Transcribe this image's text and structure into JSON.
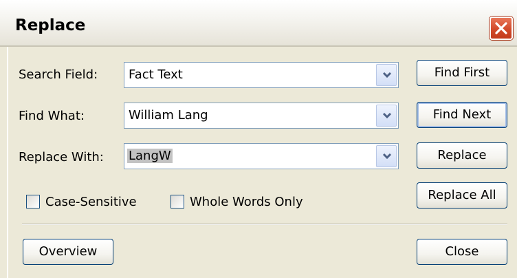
{
  "window": {
    "title": "Replace"
  },
  "fields": {
    "search_field": {
      "label": "Search Field:",
      "value": "Fact Text"
    },
    "find_what": {
      "label": "Find What:",
      "value": "William Lang"
    },
    "replace_with": {
      "label": "Replace With:",
      "value": "LangW"
    }
  },
  "options": {
    "case_sensitive": {
      "label": "Case-Sensitive",
      "checked": false
    },
    "whole_words": {
      "label": "Whole Words Only",
      "checked": false
    }
  },
  "buttons": {
    "find_first": "Find First",
    "find_next": "Find Next",
    "replace": "Replace",
    "replace_all": "Replace All",
    "overview": "Overview",
    "close": "Close"
  },
  "icons": {
    "close": "close-icon",
    "dropdown": "chevron-down-icon"
  },
  "colors": {
    "dialog_bg": "#ece9d8",
    "close_button": "#d24a2a",
    "button_border": "#003c74",
    "field_border": "#7f9db9"
  }
}
